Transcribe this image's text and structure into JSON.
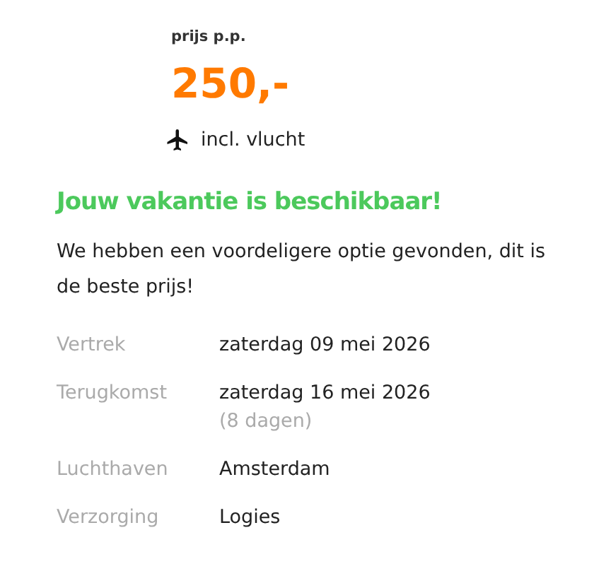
{
  "price": {
    "label": "prijs p.p.",
    "amount": "250,-",
    "includes": "incl. vlucht"
  },
  "availability": {
    "title": "Jouw vakantie is beschikbaar!",
    "message": "We hebben een voordeligere optie gevonden, dit is de beste prijs!"
  },
  "details": [
    {
      "label": "Vertrek",
      "value": "zaterdag 09 mei 2026"
    },
    {
      "label": "Terugkomst",
      "value": "zaterdag 16 mei 2026",
      "note": "(8 dagen)"
    },
    {
      "label": "Luchthaven",
      "value": "Amsterdam"
    },
    {
      "label": "Verzorging",
      "value": "Logies"
    }
  ]
}
